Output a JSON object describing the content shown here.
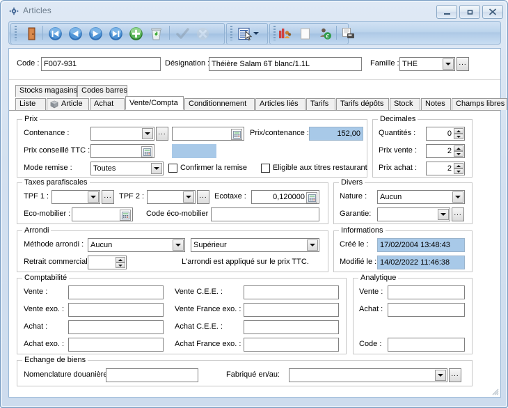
{
  "window": {
    "title": "Articles",
    "icon": "app-articles-icon",
    "buttons": {
      "minimize": "–",
      "maximize": "□",
      "close": "✕"
    }
  },
  "toolbar": {
    "items": [
      {
        "name": "exit-door-icon",
        "label": "Quitter",
        "enabled": true
      },
      {
        "name": "first-record-icon",
        "label": "Premier",
        "enabled": true
      },
      {
        "name": "previous-record-icon",
        "label": "Précédent",
        "enabled": true
      },
      {
        "name": "next-record-icon",
        "label": "Suivant",
        "enabled": true
      },
      {
        "name": "last-record-icon",
        "label": "Dernier",
        "enabled": true
      },
      {
        "name": "add-record-icon",
        "label": "Ajouter",
        "enabled": true
      },
      {
        "name": "delete-record-icon",
        "label": "Supprimer",
        "enabled": true
      },
      {
        "name": "validate-check-icon",
        "label": "Valider",
        "enabled": false
      },
      {
        "name": "cancel-icon",
        "label": "Annuler",
        "enabled": false
      },
      {
        "name": "list-view-icon",
        "label": "Liste",
        "enabled": true
      },
      {
        "name": "stock-chart-icon",
        "label": "Statistiques",
        "enabled": true
      },
      {
        "name": "document-icon",
        "label": "Document",
        "enabled": true
      },
      {
        "name": "customers-euro-icon",
        "label": "Clients",
        "enabled": true
      },
      {
        "name": "print-icon",
        "label": "Imprimer",
        "enabled": true
      }
    ]
  },
  "header": {
    "code_label": "Code :",
    "code_value": "F007-931",
    "designation_label": "Désignation :",
    "designation_value": "Théière Salam 6T blanc/1.1L",
    "famille_label": "Famille :",
    "famille_value": "THE"
  },
  "tabs_top": [
    {
      "label": "Stocks magasins",
      "selected": false
    },
    {
      "label": "Codes barres",
      "selected": false
    }
  ],
  "tabs_main": [
    {
      "label": "Liste",
      "selected": false,
      "icon": null
    },
    {
      "label": "Article",
      "selected": false,
      "icon": "article-box-icon"
    },
    {
      "label": "Achat",
      "selected": false,
      "icon": null
    },
    {
      "label": "Vente/Compta",
      "selected": true,
      "icon": null
    },
    {
      "label": "Conditionnement",
      "selected": false,
      "icon": null
    },
    {
      "label": "Articles liés",
      "selected": false,
      "icon": null
    },
    {
      "label": "Tarifs",
      "selected": false,
      "icon": null
    },
    {
      "label": "Tarifs dépôts",
      "selected": false,
      "icon": null
    },
    {
      "label": "Stock",
      "selected": false,
      "icon": null
    },
    {
      "label": "Notes",
      "selected": false,
      "icon": null
    },
    {
      "label": "Champs libres",
      "selected": false,
      "icon": null
    }
  ],
  "prix": {
    "caption": "Prix",
    "contenance_label": "Contenance :",
    "contenance_value": "",
    "contenance_unit_value": "",
    "prix_contenance_label": "Prix/contenance :",
    "prix_contenance_value": "152,00",
    "prix_conseille_label": "Prix conseillé TTC :",
    "prix_conseille_value": "",
    "prix_conseille_ht_value": "",
    "mode_remise_label": "Mode remise :",
    "mode_remise_value": "Toutes",
    "confirmer_remise_label": "Confirmer la remise",
    "confirmer_remise_checked": false,
    "eligible_titres_label": "Eligible aux titres restaurant",
    "eligible_titres_checked": false
  },
  "decimales": {
    "caption": "Decimales",
    "quantites_label": "Quantités :",
    "quantites_value": "0",
    "prix_vente_label": "Prix vente :",
    "prix_vente_value": "2",
    "prix_achat_label": "Prix achat :",
    "prix_achat_value": "2"
  },
  "taxes": {
    "caption": "Taxes parafiscales",
    "tpf1_label": "TPF 1 :",
    "tpf1_value": "",
    "tpf2_label": "TPF 2 :",
    "tpf2_value": "",
    "ecotaxe_label": "Ecotaxe :",
    "ecotaxe_value": "0,120000",
    "ecomobilier_label": "Eco-mobilier :",
    "ecomobilier_value": "",
    "code_ecomobilier_label": "Code éco-mobilier :",
    "code_ecomobilier_value": ""
  },
  "divers": {
    "caption": "Divers",
    "nature_label": "Nature :",
    "nature_value": "Aucun",
    "garantie_label": "Garantie:",
    "garantie_value": ""
  },
  "arrondi": {
    "caption": "Arrondi",
    "methode_label": "Méthode arrondi :",
    "methode_value": "Aucun",
    "sens_value": "Supérieur",
    "retrait_label": "Retrait commercial :",
    "retrait_value": "",
    "note": "L'arrondi est appliqué sur le prix TTC."
  },
  "informations": {
    "caption": "Informations",
    "cree_label": "Créé le :",
    "cree_value": "17/02/2004 13:48:43",
    "modifie_label": "Modifié le :",
    "modifie_value": "14/02/2022 11:46:38"
  },
  "comptabilite": {
    "caption": "Comptabilité",
    "rows": [
      {
        "left_label": "Vente :",
        "left_value": "",
        "right_label": "Vente C.E.E. :",
        "right_value": ""
      },
      {
        "left_label": "Vente exo. :",
        "left_value": "",
        "right_label": "Vente France exo. :",
        "right_value": ""
      },
      {
        "left_label": "Achat :",
        "left_value": "",
        "right_label": "Achat C.E.E. :",
        "right_value": ""
      },
      {
        "left_label": "Achat exo. :",
        "left_value": "",
        "right_label": "Achat France exo. :",
        "right_value": ""
      }
    ]
  },
  "analytique": {
    "caption": "Analytique",
    "vente_label": "Vente :",
    "vente_value": "",
    "achat_label": "Achat :",
    "achat_value": "",
    "code_label": "Code :",
    "code_value": ""
  },
  "echange": {
    "caption": "Echange de biens",
    "nomenclature_label": "Nomenclature douanière:",
    "nomenclature_value": "",
    "fabrique_label": "Fabriqué en/au:",
    "fabrique_value": ""
  },
  "colors": {
    "accent_highlight": "#a8c9e8",
    "window_frame": "#7c9fc4",
    "toolbar_blue": "#b3cde8",
    "field_border": "#808080",
    "group_border": "#c6c6c6"
  }
}
